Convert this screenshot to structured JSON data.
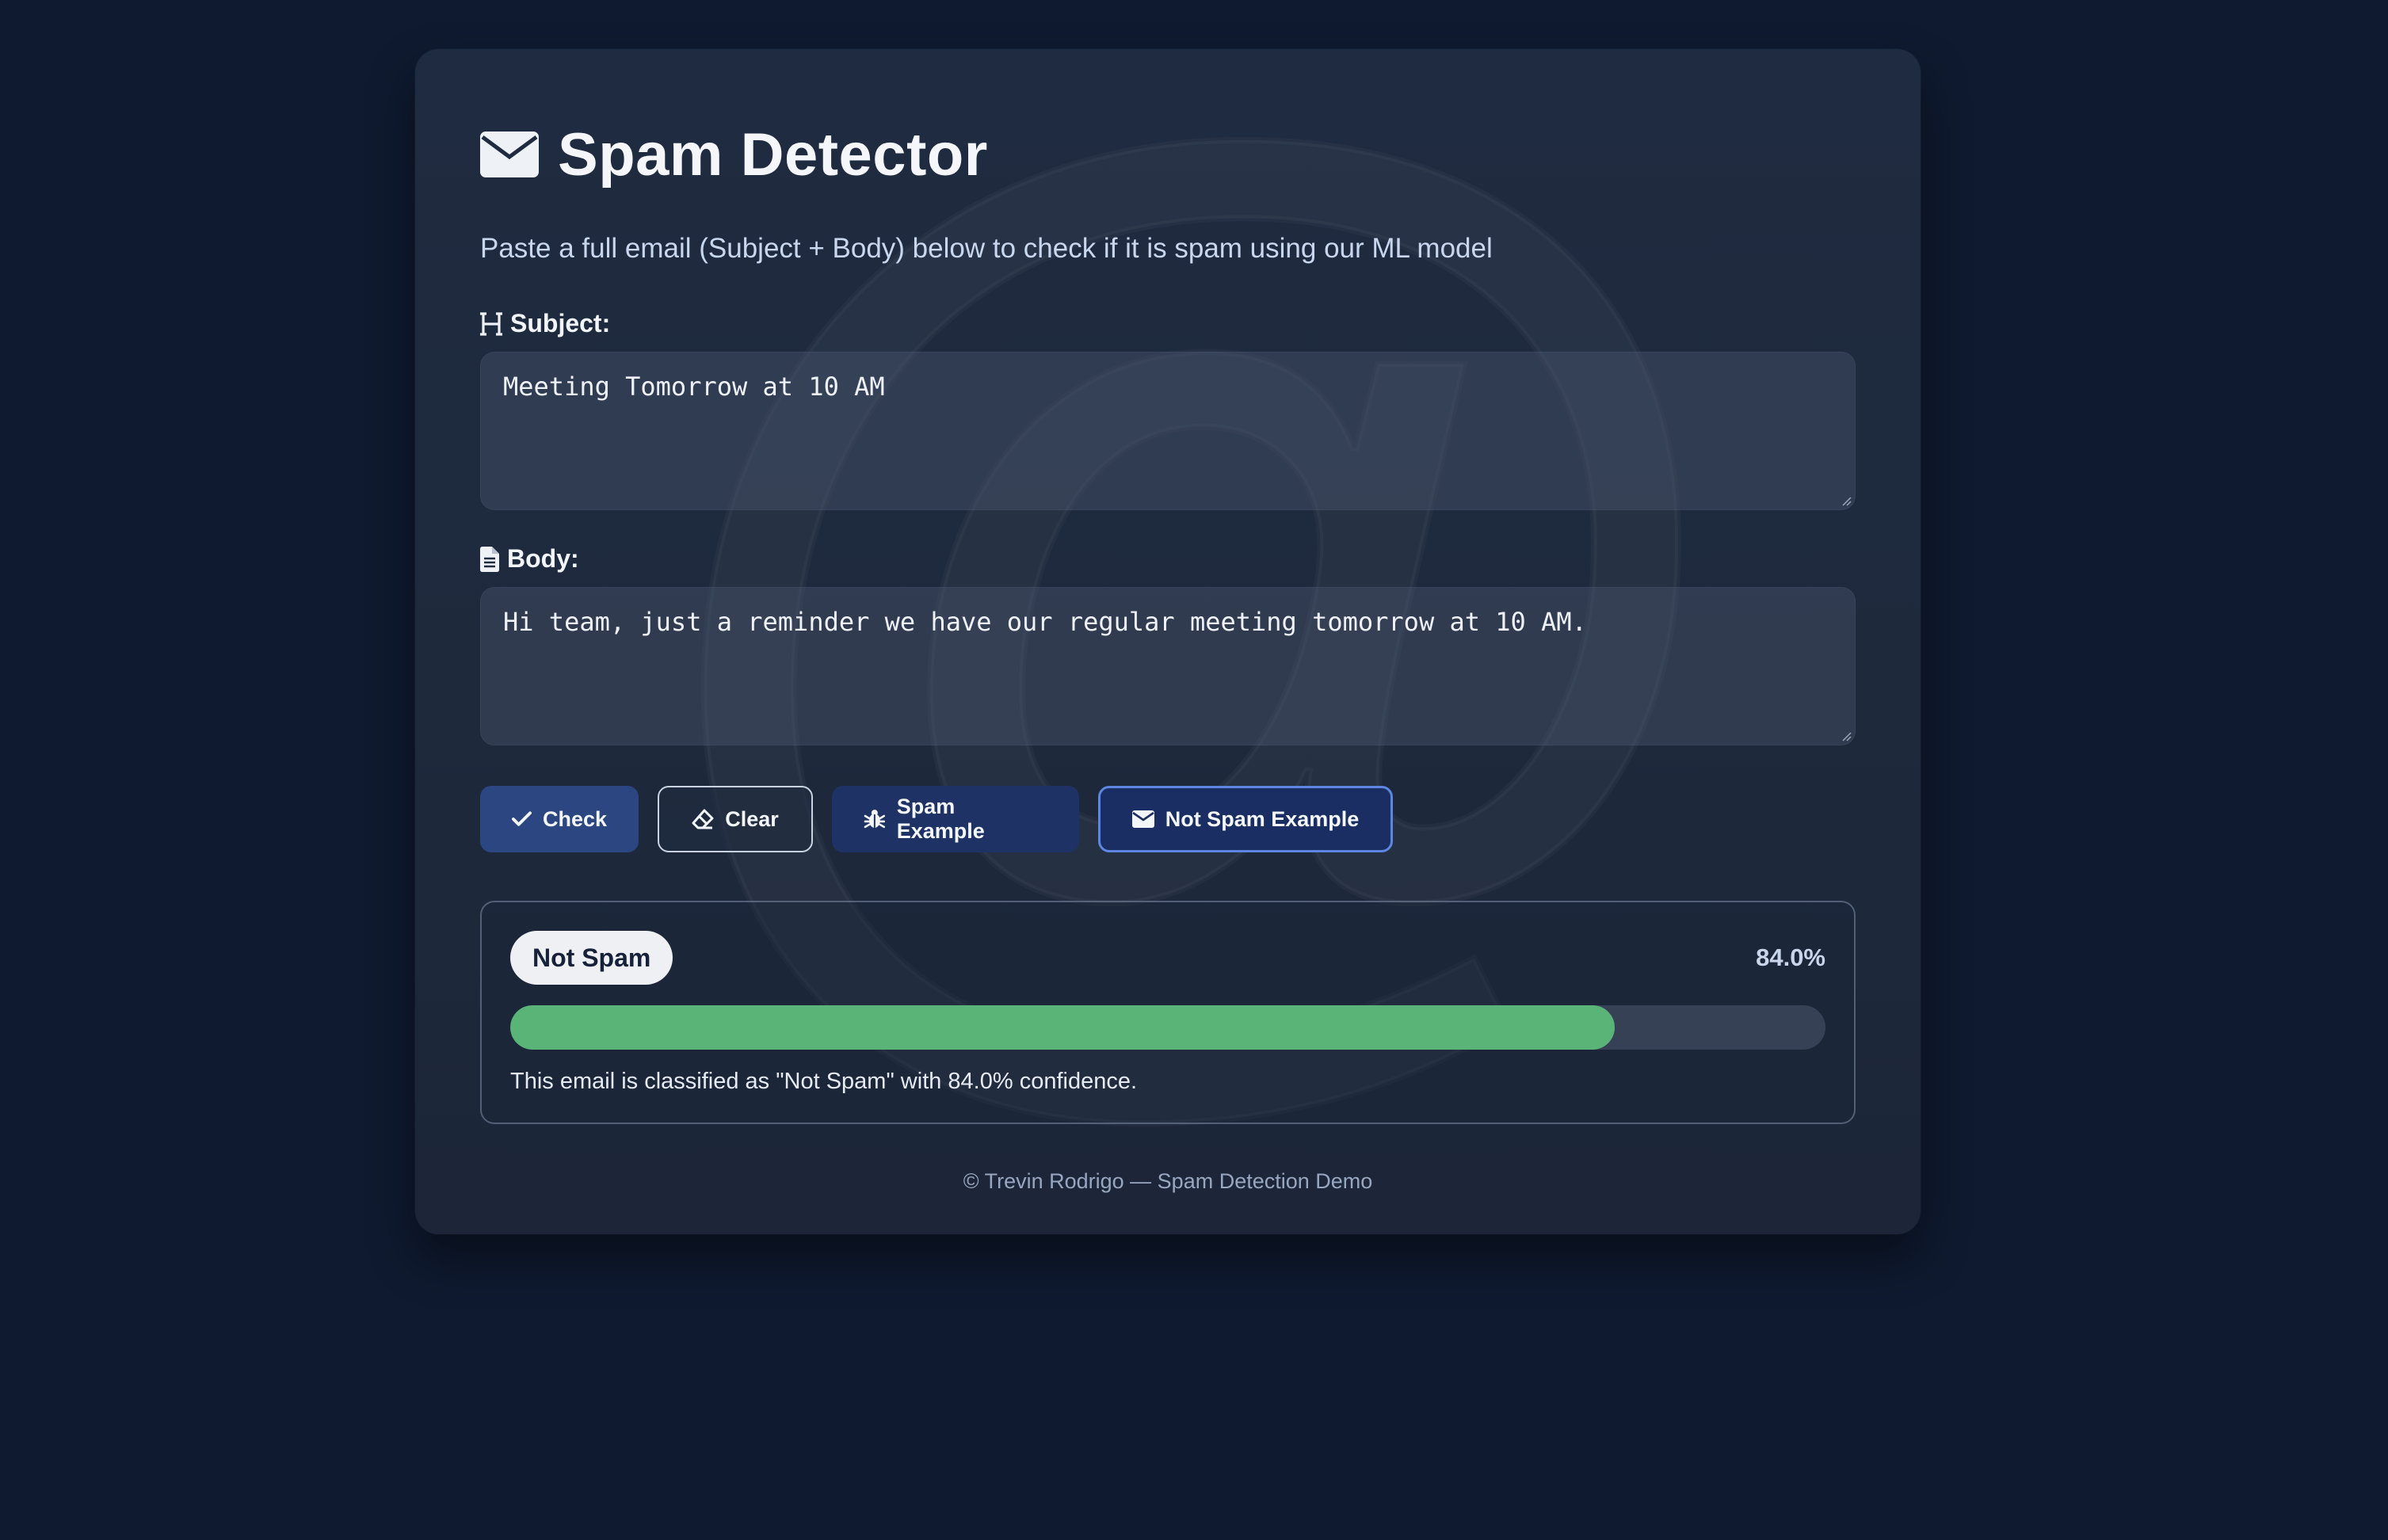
{
  "header": {
    "title": "Spam Detector",
    "title_icon": "envelope-icon",
    "subtitle": "Paste a full email (Subject + Body) below to check if it is spam using our ML model"
  },
  "subject": {
    "label": "Subject:",
    "icon": "heading-icon",
    "value": "Meeting Tomorrow at 10 AM"
  },
  "body": {
    "label": "Body:",
    "icon": "file-text-icon",
    "value": "Hi team, just a reminder we have our regular meeting tomorrow at 10 AM."
  },
  "buttons": {
    "check": "Check",
    "clear": "Clear",
    "spam_example": "Spam Example",
    "not_spam_example": "Not Spam Example"
  },
  "result": {
    "label": "Not Spam",
    "confidence_text": "84.0%",
    "confidence": 0.84,
    "message": "This email is classified as \"Not Spam\" with 84.0% confidence.",
    "bar_color": "#5bb477"
  },
  "footer": "© Trevin Rodrigo — Spam Detection Demo",
  "colors": {
    "page_bg": "#0f1a30",
    "card_bg": "#1f2b40",
    "accent": "#2b4680",
    "success": "#5bb477"
  }
}
